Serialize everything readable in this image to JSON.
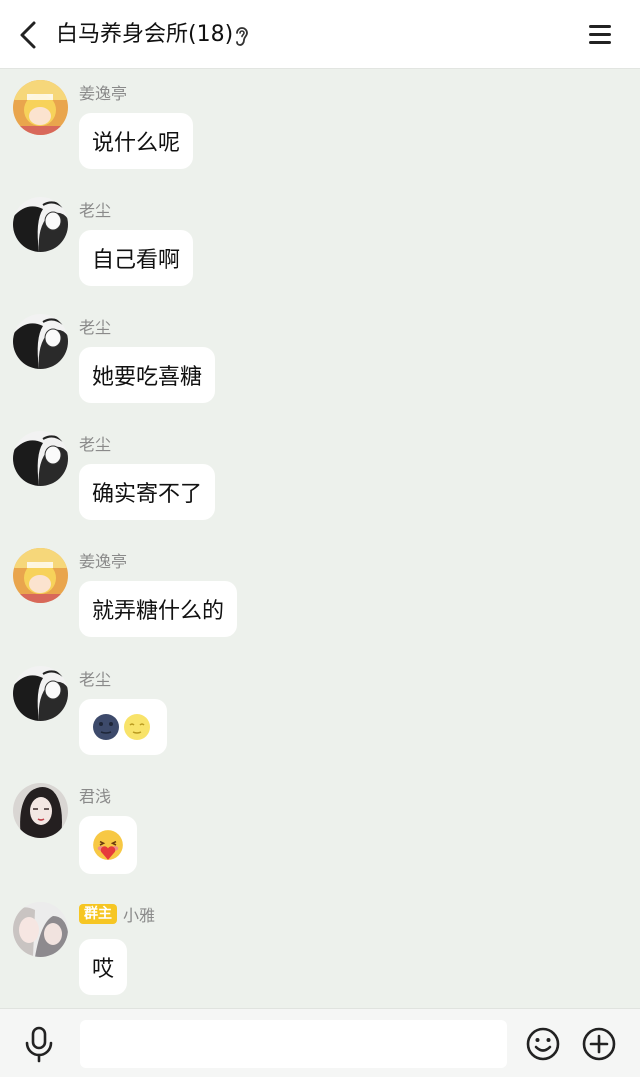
{
  "header": {
    "title": "白马养身会所(18)",
    "icons": {
      "back": "chevron-left-icon",
      "ear": "ear-icon",
      "menu": "menu-icon"
    }
  },
  "messages": [
    {
      "sender": "姜逸亭",
      "text": "说什么呢",
      "avatar": "anime-blonde-avatar"
    },
    {
      "sender": "老尘",
      "text": "自己看啊",
      "avatar": "manga-couple-avatar"
    },
    {
      "sender": "老尘",
      "text": "她要吃喜糖",
      "avatar": "manga-couple-avatar"
    },
    {
      "sender": "老尘",
      "text": "确实寄不了",
      "avatar": "manga-couple-avatar"
    },
    {
      "sender": "姜逸亭",
      "text": "就弄糖什么的",
      "avatar": "anime-blonde-avatar"
    },
    {
      "sender": "老尘",
      "emojis": [
        "new-moon-face-emoji",
        "full-moon-face-emoji"
      ],
      "avatar": "manga-couple-avatar"
    },
    {
      "sender": "君浅",
      "emojis": [
        "face-holding-back-heart-emoji"
      ],
      "avatar": "dark-hair-girl-avatar"
    },
    {
      "sender": "小雅",
      "badge": "群主",
      "text": "哎",
      "avatar": "photo-avatar"
    }
  ],
  "input_bar": {
    "value": "",
    "placeholder": "",
    "icons": {
      "voice": "microphone-icon",
      "emoji": "smiley-icon",
      "more": "plus-circle-icon"
    }
  },
  "colors": {
    "chat_background": "#edf1ec",
    "bubble": "#ffffff",
    "badge": "#f6c623",
    "sender_name": "#8a8a8a"
  }
}
